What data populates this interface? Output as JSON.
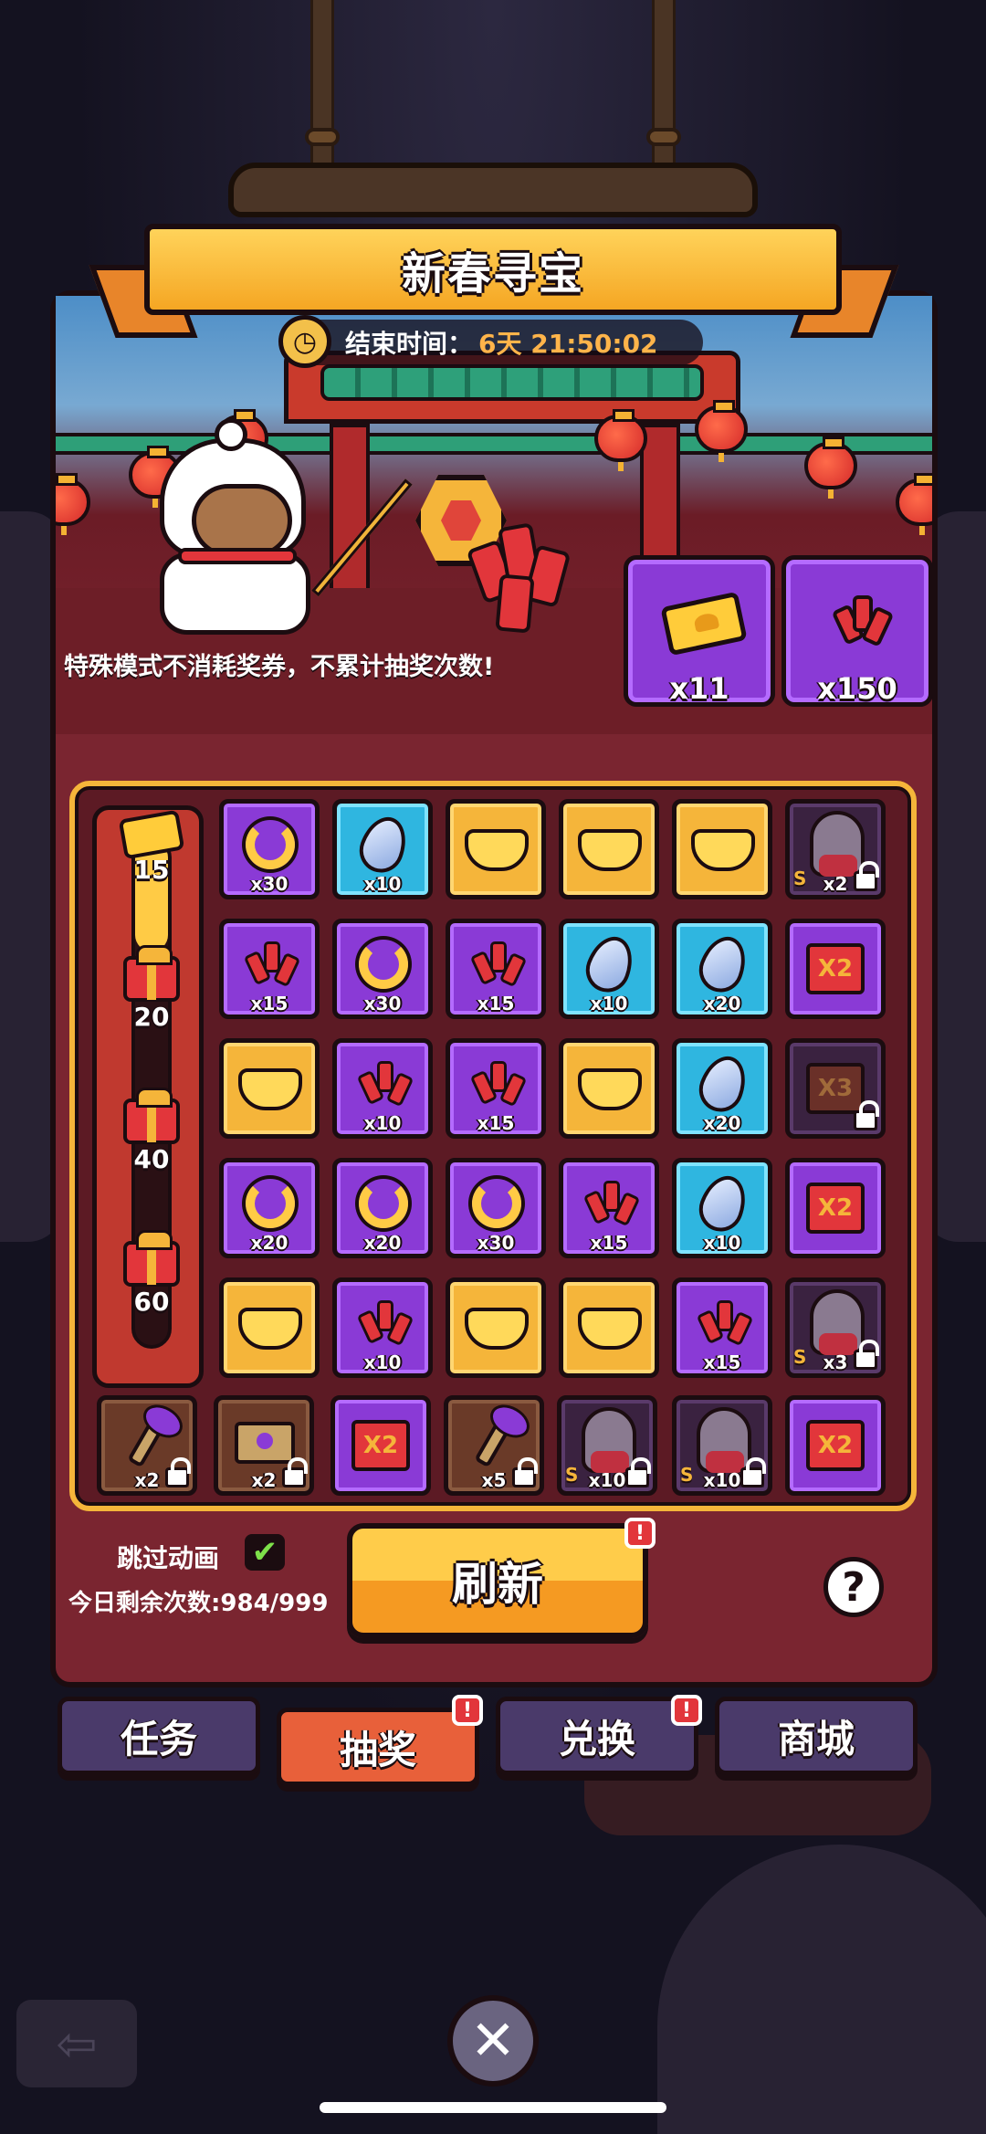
{
  "header": {
    "title": "新春寻宝",
    "timer_label": "结束时间：",
    "timer_value": "6天 21:50:02"
  },
  "scene": {
    "notice": "特殊模式不消耗奖券，不累计抽奖次数!"
  },
  "currencies": [
    {
      "icon": "ticket-icon",
      "count": "x11"
    },
    {
      "icon": "firecracker-icon",
      "count": "x150"
    }
  ],
  "progress": {
    "fill_fraction": 0.22,
    "milestones": [
      {
        "value": "15",
        "reward": "ticket"
      },
      {
        "value": "20",
        "reward": "gift"
      },
      {
        "value": "40",
        "reward": "gift"
      },
      {
        "value": "60",
        "reward": "gift"
      }
    ]
  },
  "grid": {
    "rows": [
      [
        {
          "type": "horseshoe",
          "bg": "purple",
          "qty": "x30"
        },
        {
          "type": "crystal",
          "bg": "blue",
          "qty": "x10"
        },
        {
          "type": "ingot",
          "bg": "gold",
          "qty": ""
        },
        {
          "type": "ingot",
          "bg": "gold",
          "qty": ""
        },
        {
          "type": "ingot",
          "bg": "gold",
          "qty": ""
        },
        {
          "type": "character",
          "bg": "dark",
          "qty": "x2",
          "locked": true,
          "tag": "S"
        }
      ],
      [
        {
          "type": "firecracker",
          "bg": "purple",
          "qty": "x15"
        },
        {
          "type": "horseshoe",
          "bg": "purple",
          "qty": "x30"
        },
        {
          "type": "firecracker",
          "bg": "purple",
          "qty": "x15"
        },
        {
          "type": "crystal",
          "bg": "blue",
          "qty": "x10"
        },
        {
          "type": "crystal",
          "bg": "blue",
          "qty": "x20"
        },
        {
          "type": "multiplier",
          "bg": "purple",
          "label": "X2"
        }
      ],
      [
        {
          "type": "ingot",
          "bg": "gold",
          "qty": ""
        },
        {
          "type": "firecracker",
          "bg": "purple",
          "qty": "x10"
        },
        {
          "type": "firecracker",
          "bg": "purple",
          "qty": "x15"
        },
        {
          "type": "ingot",
          "bg": "gold",
          "qty": ""
        },
        {
          "type": "crystal",
          "bg": "blue",
          "qty": "x20"
        },
        {
          "type": "multiplier",
          "bg": "dark",
          "label": "X3",
          "locked": true
        }
      ],
      [
        {
          "type": "horseshoe",
          "bg": "purple",
          "qty": "x20"
        },
        {
          "type": "horseshoe",
          "bg": "purple",
          "qty": "x20"
        },
        {
          "type": "horseshoe",
          "bg": "purple",
          "qty": "x30"
        },
        {
          "type": "firecracker",
          "bg": "purple",
          "qty": "x15"
        },
        {
          "type": "crystal",
          "bg": "blue",
          "qty": "x10"
        },
        {
          "type": "multiplier",
          "bg": "purple",
          "label": "X2"
        }
      ],
      [
        {
          "type": "ingot",
          "bg": "gold",
          "qty": ""
        },
        {
          "type": "firecracker",
          "bg": "purple",
          "qty": "x10"
        },
        {
          "type": "ingot",
          "bg": "gold",
          "qty": ""
        },
        {
          "type": "ingot",
          "bg": "gold",
          "qty": ""
        },
        {
          "type": "firecracker",
          "bg": "purple",
          "qty": "x15"
        },
        {
          "type": "character",
          "bg": "dark",
          "qty": "x3",
          "locked": true,
          "tag": "S"
        }
      ]
    ],
    "bottom_row": [
      {
        "type": "key",
        "bg": "brown",
        "qty": "x2",
        "locked": true
      },
      {
        "type": "letter",
        "bg": "brown",
        "qty": "x2",
        "locked": true
      },
      {
        "type": "multiplier",
        "bg": "purple",
        "label": "X2"
      },
      {
        "type": "key",
        "bg": "brown",
        "qty": "x5",
        "locked": true
      },
      {
        "type": "character",
        "bg": "dark",
        "qty": "x10",
        "locked": true,
        "tag": "S"
      },
      {
        "type": "character",
        "bg": "dark",
        "qty": "x10",
        "locked": true,
        "tag": "S"
      },
      {
        "type": "multiplier",
        "bg": "purple",
        "label": "X2"
      }
    ]
  },
  "controls": {
    "skip_label": "跳过动画",
    "skip_checked": "✔",
    "remain_label": "今日剩余次数:984/999",
    "refresh_label": "刷新",
    "badge": "!",
    "help": "?"
  },
  "tabs": [
    {
      "label": "任务",
      "active": false,
      "badge": false
    },
    {
      "label": "抽奖",
      "active": true,
      "badge": true
    },
    {
      "label": "兑换",
      "active": false,
      "badge": true
    },
    {
      "label": "商城",
      "active": false,
      "badge": false
    }
  ],
  "nav": {
    "close": "✕",
    "back": "⇦"
  }
}
